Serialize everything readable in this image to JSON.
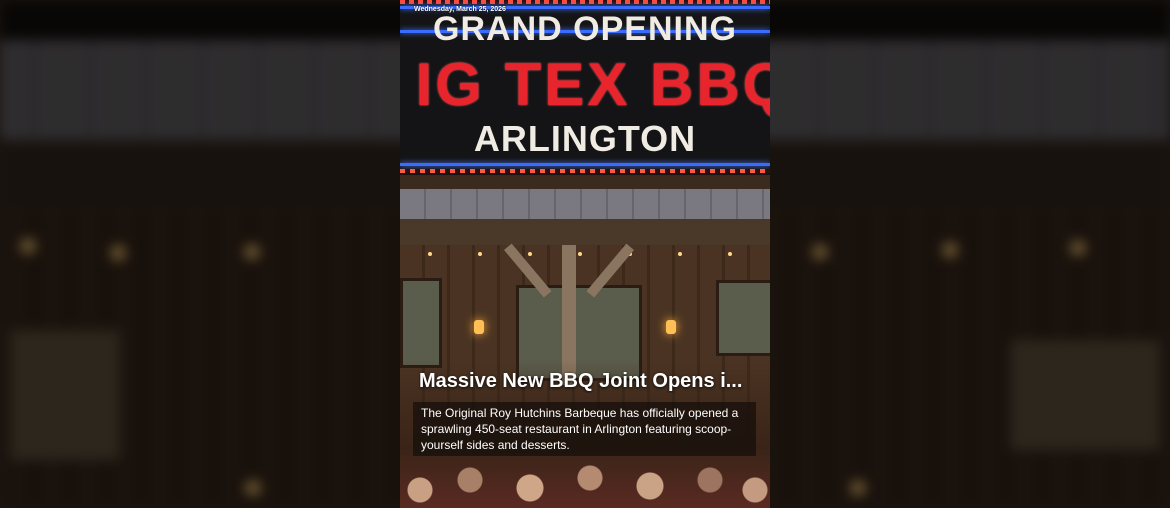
{
  "post": {
    "date": "Wednesday, March 25, 2026",
    "sign_lines": [
      "GRAND OPENING",
      "IG TEX BBQ",
      "ARLINGTON"
    ],
    "headline": "Massive New BBQ Joint Opens i...",
    "summary": "The Original Roy Hutchins Barbeque has officially opened a sprawling 450-seat restaurant in Arlington featuring scoop-yourself sides and desserts."
  },
  "colors": {
    "sign_red": "#e8242c",
    "neon_blue": "#3a6cff",
    "text_white": "#ffffff"
  }
}
